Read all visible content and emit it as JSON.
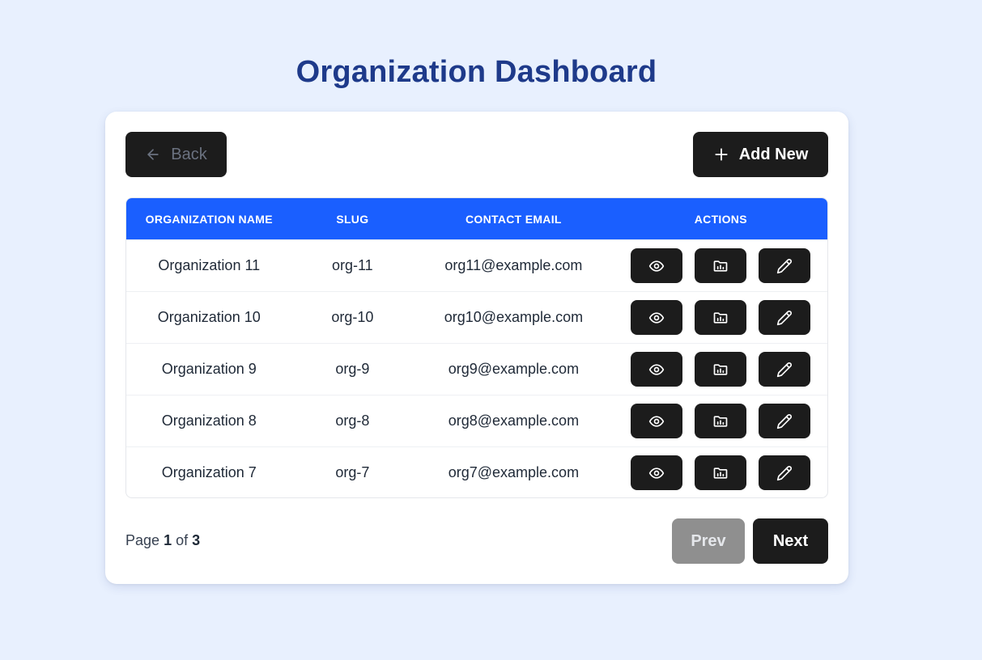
{
  "page": {
    "title": "Organization Dashboard"
  },
  "toolbar": {
    "back_label": "Back",
    "add_label": "Add New"
  },
  "table": {
    "headers": [
      "ORGANIZATION NAME",
      "SLUG",
      "CONTACT EMAIL",
      "ACTIONS"
    ],
    "rows": [
      {
        "name": "Organization 11",
        "slug": "org-11",
        "email": "org11@example.com"
      },
      {
        "name": "Organization 10",
        "slug": "org-10",
        "email": "org10@example.com"
      },
      {
        "name": "Organization 9",
        "slug": "org-9",
        "email": "org9@example.com"
      },
      {
        "name": "Organization 8",
        "slug": "org-8",
        "email": "org8@example.com"
      },
      {
        "name": "Organization 7",
        "slug": "org-7",
        "email": "org7@example.com"
      }
    ],
    "row_action_icons": [
      "eye-icon",
      "folder-chart-icon",
      "pencil-icon"
    ]
  },
  "pagination": {
    "page_word": "Page",
    "current": "1",
    "of_word": "of",
    "total": "3",
    "prev_label": "Prev",
    "next_label": "Next"
  },
  "colors": {
    "background": "#e8f0fe",
    "title": "#1e3a8a",
    "header": "#1a5fff",
    "button_dark": "#1c1c1c",
    "button_disabled": "#8f8f8f"
  }
}
